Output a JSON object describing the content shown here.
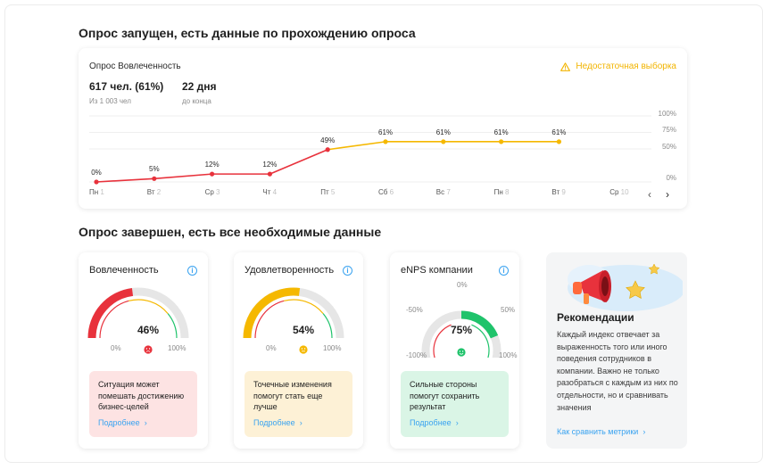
{
  "section1_title": "Опрос запущен, есть данные по прохождению опроса",
  "section2_title": "Опрос завершен, есть все необходимые данные",
  "survey_card": {
    "title": "Опрос Вовлеченность",
    "warning": "Недостаточная выборка",
    "stats": [
      {
        "value": "617 чел. (61%)",
        "label": "Из 1 003 чел"
      },
      {
        "value": "22 дня",
        "label": "до конца"
      }
    ],
    "y_ticks": [
      "100%",
      "75%",
      "50%",
      "0%"
    ],
    "nav_prev": "‹",
    "nav_next": "›"
  },
  "chart_data": {
    "type": "line",
    "x": [
      {
        "day": "Пн",
        "num": "1"
      },
      {
        "day": "Вт",
        "num": "2"
      },
      {
        "day": "Ср",
        "num": "3"
      },
      {
        "day": "Чт",
        "num": "4"
      },
      {
        "day": "Пт",
        "num": "5"
      },
      {
        "day": "Сб",
        "num": "6"
      },
      {
        "day": "Вс",
        "num": "7"
      },
      {
        "day": "Пн",
        "num": "8"
      },
      {
        "day": "Вт",
        "num": "9"
      },
      {
        "day": "Ср",
        "num": "10"
      }
    ],
    "values": [
      0,
      5,
      12,
      12,
      49,
      61,
      61,
      61,
      61
    ],
    "labels": [
      "0%",
      "5%",
      "12%",
      "12%",
      "49%",
      "61%",
      "61%",
      "61%",
      "61%"
    ],
    "ylim": [
      0,
      100
    ],
    "colors": {
      "low": "#e8323c",
      "high": "#f5b800"
    }
  },
  "metrics": [
    {
      "title": "Вовлеченность",
      "value": "46%",
      "min_label": "0%",
      "max_label": "100%",
      "level": 0.46,
      "color": "#e8323c",
      "face": "sad-face-icon",
      "face_color": "#e8323c",
      "note": "Ситуация может помешать достижению бизнес-целей",
      "note_bg": "#fde3e3",
      "more": "Подробнее",
      "info": "i"
    },
    {
      "title": "Удовлетворенность",
      "value": "54%",
      "min_label": "0%",
      "max_label": "100%",
      "level": 0.54,
      "color": "#f5b800",
      "face": "neutral-face-icon",
      "face_color": "#f5b800",
      "note": "Точечные изменения помогут стать еще лучше",
      "note_bg": "#fdf1d6",
      "more": "Подробнее",
      "info": "i"
    },
    {
      "title": "eNPS компании",
      "value": "75%",
      "min_label": "-100%",
      "max_label": "100%",
      "mid_left": "-50%",
      "top_label": "0%",
      "mid_right": "50%",
      "level": 0.75,
      "color": "#1fc36b",
      "face": "happy-face-icon",
      "face_color": "#1fc36b",
      "note": "Сильные стороны помогут сохранить результат",
      "note_bg": "#daf5e6",
      "more": "Подробнее",
      "info": "i"
    }
  ],
  "recommendations": {
    "title": "Рекомендации",
    "text": "Каждый индекс отвечает за выраженность того или иного поведения сотрудников в компании. Важно не только разобраться с каждым из них по отдельности, но и сравнивать значения",
    "link": "Как сравнить метрики"
  }
}
